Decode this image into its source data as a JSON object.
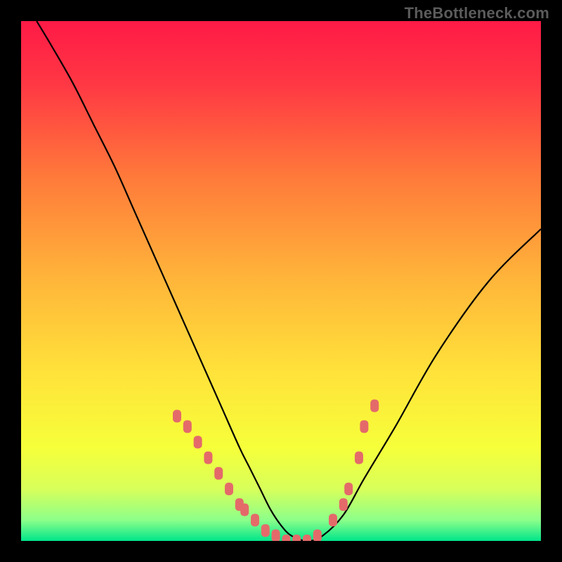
{
  "watermark": "TheBottleneck.com",
  "chart_data": {
    "type": "line",
    "title": "",
    "xlabel": "",
    "ylabel": "",
    "xlim": [
      0,
      100
    ],
    "ylim": [
      0,
      100
    ],
    "grid": false,
    "legend": false,
    "background": {
      "kind": "vertical-gradient",
      "stops": [
        {
          "pos": 0.0,
          "color": "#ff1a46"
        },
        {
          "pos": 0.12,
          "color": "#ff3744"
        },
        {
          "pos": 0.3,
          "color": "#ff7a3a"
        },
        {
          "pos": 0.5,
          "color": "#ffb63a"
        },
        {
          "pos": 0.68,
          "color": "#ffe33a"
        },
        {
          "pos": 0.82,
          "color": "#f6ff3a"
        },
        {
          "pos": 0.9,
          "color": "#d8ff5a"
        },
        {
          "pos": 0.96,
          "color": "#8cff8a"
        },
        {
          "pos": 1.0,
          "color": "#00e58a"
        }
      ]
    },
    "series": [
      {
        "name": "bottleneck-curve",
        "color": "#000000",
        "x": [
          3,
          6,
          10,
          14,
          18,
          22,
          26,
          30,
          34,
          38,
          42,
          44,
          46,
          48,
          50,
          52,
          55,
          58,
          62,
          66,
          72,
          80,
          90,
          100
        ],
        "y": [
          100,
          95,
          88,
          80,
          72,
          63,
          54,
          45,
          36,
          27,
          18,
          14,
          10,
          6,
          3,
          1,
          0,
          1,
          5,
          12,
          22,
          36,
          50,
          60
        ]
      },
      {
        "name": "highlight-markers",
        "color": "#e46a6a",
        "marker": "rounded-rect",
        "x": [
          30,
          32,
          34,
          36,
          38,
          40,
          42,
          43,
          45,
          47,
          49,
          51,
          53,
          55,
          57,
          60,
          62,
          63,
          65,
          66,
          68
        ],
        "y": [
          24,
          22,
          19,
          16,
          13,
          10,
          7,
          6,
          4,
          2,
          1,
          0,
          0,
          0,
          1,
          4,
          7,
          10,
          16,
          22,
          26
        ]
      }
    ]
  }
}
